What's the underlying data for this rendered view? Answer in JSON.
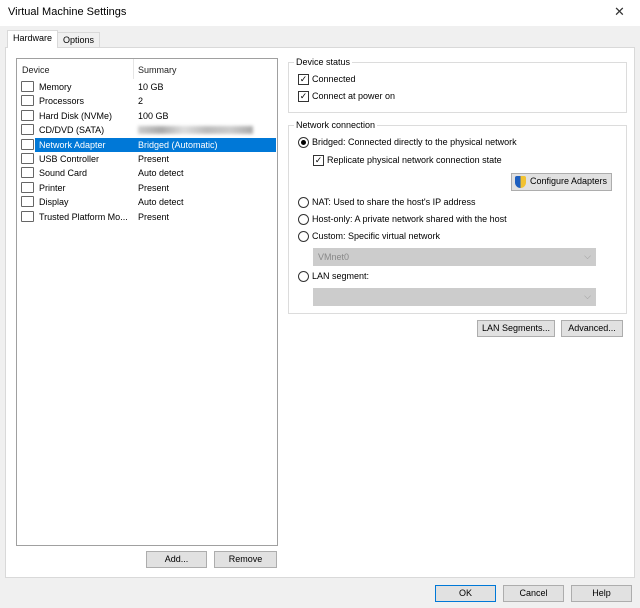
{
  "window": {
    "title": "Virtual Machine Settings"
  },
  "tabs": [
    {
      "label": "Hardware",
      "active": true
    },
    {
      "label": "Options",
      "active": false
    }
  ],
  "devices": {
    "headers": {
      "device": "Device",
      "summary": "Summary"
    },
    "rows": [
      {
        "icon": "memory-icon",
        "device": "Memory",
        "summary": "10 GB"
      },
      {
        "icon": "processor-icon",
        "device": "Processors",
        "summary": "2"
      },
      {
        "icon": "hard-disk-icon",
        "device": "Hard Disk (NVMe)",
        "summary": "100 GB"
      },
      {
        "icon": "cd-dvd-icon",
        "device": "CD/DVD (SATA)",
        "summary": null,
        "summary_blurred": true
      },
      {
        "icon": "network-adapter-icon",
        "device": "Network Adapter",
        "summary": "Bridged (Automatic)",
        "selected": true
      },
      {
        "icon": "usb-icon",
        "device": "USB Controller",
        "summary": "Present"
      },
      {
        "icon": "sound-icon",
        "device": "Sound Card",
        "summary": "Auto detect"
      },
      {
        "icon": "printer-icon",
        "device": "Printer",
        "summary": "Present"
      },
      {
        "icon": "display-icon",
        "device": "Display",
        "summary": "Auto detect"
      },
      {
        "icon": "tpm-icon",
        "device": "Trusted Platform Mo...",
        "summary": "Present"
      }
    ],
    "add_label": "Add...",
    "remove_label": "Remove"
  },
  "device_status": {
    "title": "Device status",
    "connected": {
      "label": "Connected",
      "checked": true
    },
    "connect_power_on": {
      "label": "Connect at power on",
      "checked": true
    }
  },
  "network": {
    "title": "Network connection",
    "bridged": "Bridged: Connected directly to the physical network",
    "replicate": {
      "label": "Replicate physical network connection state",
      "checked": true
    },
    "configure_label": "Configure Adapters",
    "nat": "NAT: Used to share the host's IP address",
    "host_only": "Host-only: A private network shared with the host",
    "custom": "Custom: Specific virtual network",
    "custom_value": "VMnet0",
    "lan": "LAN segment:",
    "lan_value": "",
    "selected": "bridged"
  },
  "lan_segments_label": "LAN Segments...",
  "advanced_label": "Advanced...",
  "footer": {
    "ok": "OK",
    "cancel": "Cancel",
    "help": "Help"
  }
}
